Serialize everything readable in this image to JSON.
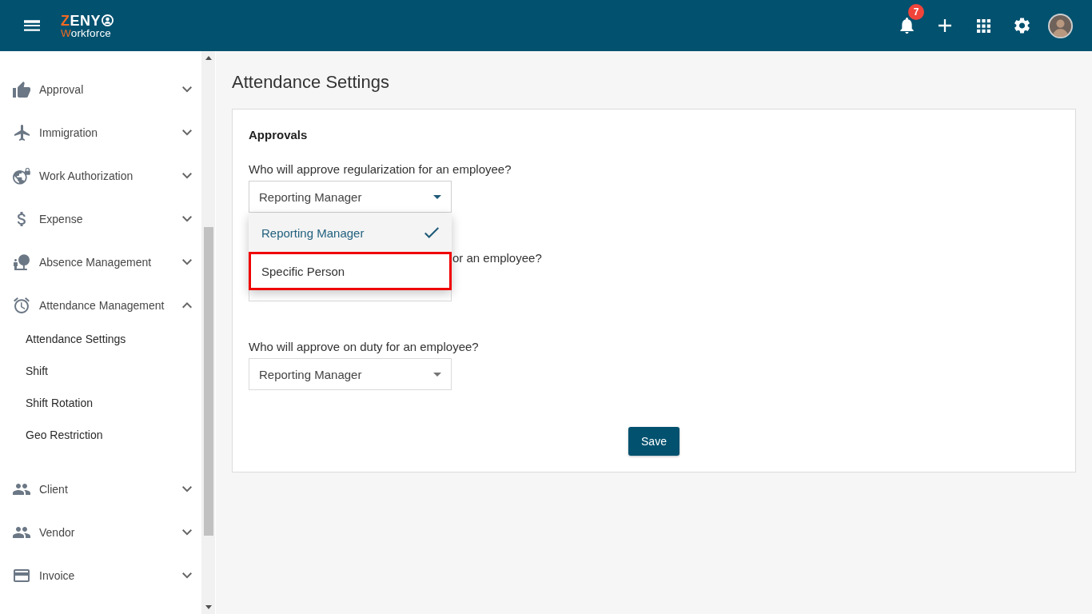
{
  "header": {
    "logo": {
      "top": {
        "accent": "Z",
        "rest": "ENY"
      },
      "bottom": {
        "accent": "W",
        "rest": "orkforce"
      }
    },
    "notifications": {
      "count": "7"
    }
  },
  "sidebar": {
    "items": [
      {
        "label": "Approval",
        "expanded": false
      },
      {
        "label": "Immigration",
        "expanded": false
      },
      {
        "label": "Work Authorization",
        "expanded": false
      },
      {
        "label": "Expense",
        "expanded": false
      },
      {
        "label": "Absence Management",
        "expanded": false
      },
      {
        "label": "Attendance Management",
        "expanded": true,
        "children": [
          {
            "label": "Attendance Settings"
          },
          {
            "label": "Shift"
          },
          {
            "label": "Shift Rotation"
          },
          {
            "label": "Geo Restriction"
          }
        ]
      },
      {
        "label": "Client",
        "expanded": false
      },
      {
        "label": "Vendor",
        "expanded": false
      },
      {
        "label": "Invoice",
        "expanded": false
      }
    ]
  },
  "page": {
    "title": "Attendance Settings",
    "section_title": "Approvals",
    "questions": [
      {
        "label": "Who will approve regularization for an employee?",
        "covered": false,
        "value": "Reporting Manager",
        "open": true,
        "options": [
          {
            "label": "Reporting Manager",
            "selected": true,
            "highlighted": false
          },
          {
            "label": "Specific Person",
            "selected": false,
            "highlighted": true
          }
        ]
      },
      {
        "label": "or an employee?",
        "covered": true
      },
      {
        "label": "Who will approve on duty for an employee?",
        "covered": false,
        "value": "Reporting Manager",
        "open": false
      }
    ],
    "save_button": "Save"
  }
}
